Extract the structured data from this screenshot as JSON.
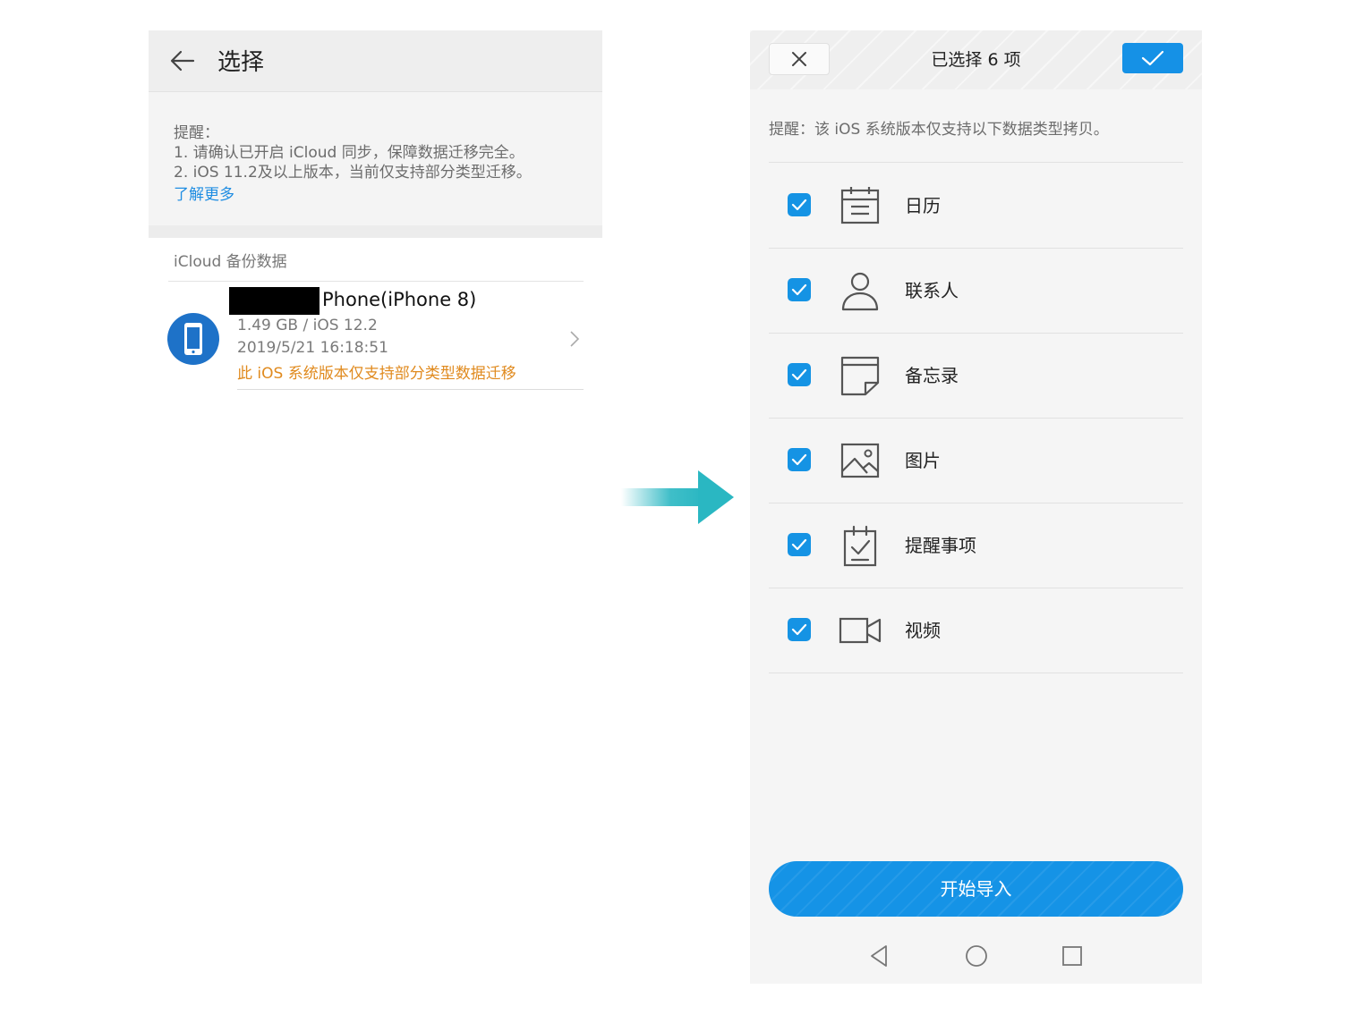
{
  "left": {
    "header": {
      "title": "选择"
    },
    "notice": {
      "heading": "提醒：",
      "line1": "1. 请确认已开启 iCloud 同步，保障数据迁移完全。",
      "line2": "2. iOS 11.2及以上版本，当前仅支持部分类型迁移。",
      "learn_more": "了解更多"
    },
    "section_title": "iCloud 备份数据",
    "backup": {
      "device_name": "Phone(iPhone 8)",
      "size_version": "1.49 GB / iOS 12.2",
      "timestamp": "2019/5/21 16:18:51",
      "warning": "此 iOS 系统版本仅支持部分类型数据迁移"
    }
  },
  "right": {
    "header": {
      "title": "已选择 6 项"
    },
    "hint": "提醒：该 iOS 系统版本仅支持以下数据类型拷贝。",
    "items": [
      {
        "label": "日历",
        "icon": "calendar-icon",
        "checked": true
      },
      {
        "label": "联系人",
        "icon": "contact-icon",
        "checked": true
      },
      {
        "label": "备忘录",
        "icon": "memo-icon",
        "checked": true
      },
      {
        "label": "图片",
        "icon": "image-icon",
        "checked": true
      },
      {
        "label": "提醒事项",
        "icon": "reminder-icon",
        "checked": true
      },
      {
        "label": "视频",
        "icon": "video-icon",
        "checked": true
      }
    ],
    "start_button": "开始导入"
  },
  "colors": {
    "accent": "#1593e6",
    "warning": "#e08a1e",
    "link": "#1f8de2",
    "arrow": "#2ab7c2"
  }
}
